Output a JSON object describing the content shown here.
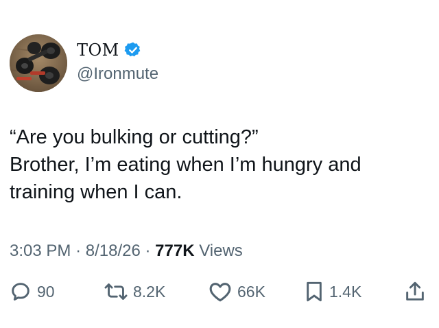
{
  "author": {
    "display_name": "TOM",
    "handle": "@Ironmute",
    "verified": true,
    "avatar_icon": "dumbbell-photo-avatar"
  },
  "tweet": {
    "lines": [
      "“Are you bulking or cutting?”",
      "Brother, I’m eating when I’m hungry and",
      "training when I can."
    ]
  },
  "meta": {
    "time": "3:03 PM",
    "separator": "·",
    "date": "8/18/26",
    "views_count": "777K",
    "views_label": "Views"
  },
  "actions": {
    "replies": "90",
    "reposts": "8.2K",
    "likes": "66K",
    "bookmarks": "1.4K"
  },
  "colors": {
    "text": "#0f1419",
    "secondary": "#536471",
    "verified_badge": "#1d9bf0"
  }
}
